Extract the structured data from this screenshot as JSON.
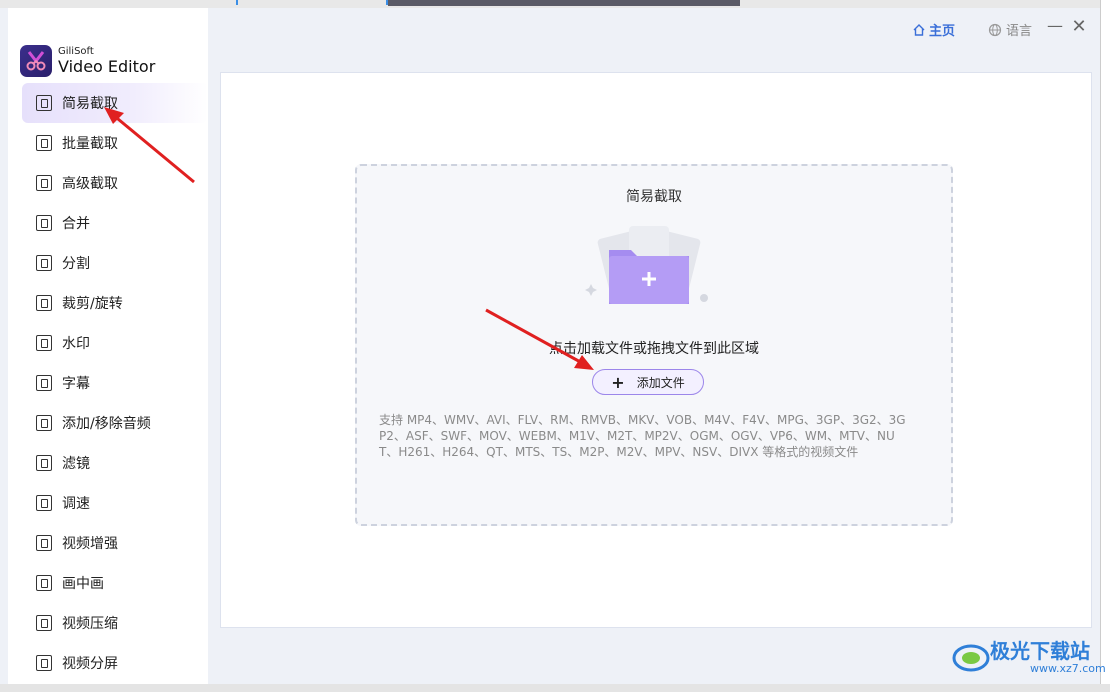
{
  "app": {
    "brand": "GiliSoft",
    "product": "Video Editor"
  },
  "topbar": {
    "home_label": "主页",
    "language_label": "语言",
    "minimize_glyph": "—",
    "close_glyph": "✕"
  },
  "sidebar": {
    "items": [
      {
        "label": "简易截取",
        "icon": "simple-cut-icon",
        "active": true
      },
      {
        "label": "批量截取",
        "icon": "batch-cut-icon"
      },
      {
        "label": "高级截取",
        "icon": "advanced-cut-icon"
      },
      {
        "label": "合并",
        "icon": "merge-icon"
      },
      {
        "label": "分割",
        "icon": "split-icon"
      },
      {
        "label": "裁剪/旋转",
        "icon": "crop-rotate-icon"
      },
      {
        "label": "水印",
        "icon": "watermark-icon"
      },
      {
        "label": "字幕",
        "icon": "subtitle-icon"
      },
      {
        "label": "添加/移除音频",
        "icon": "audio-icon"
      },
      {
        "label": "滤镜",
        "icon": "filter-icon"
      },
      {
        "label": "调速",
        "icon": "speed-icon"
      },
      {
        "label": "视频增强",
        "icon": "enhance-icon"
      },
      {
        "label": "画中画",
        "icon": "pip-icon"
      },
      {
        "label": "视频压缩",
        "icon": "compress-icon"
      },
      {
        "label": "视频分屏",
        "icon": "split-screen-icon"
      }
    ]
  },
  "dropzone": {
    "title": "简易截取",
    "hint": "点击加载文件或拖拽文件到此区域",
    "add_label": "添加文件",
    "formats": "支持 MP4、WMV、AVI、FLV、RM、RMVB、MKV、VOB、M4V、F4V、MPG、3GP、3G2、3GP2、ASF、SWF、MOV、WEBM、M1V、M2T、MP2V、OGM、OGV、VP6、WM、MTV、NUT、H261、H264、QT、MTS、TS、M2P、M2V、MPV、NSV、DIVX 等格式的视频文件"
  },
  "watermark": {
    "text": "极光下载站",
    "url": "www.xz7.com"
  },
  "colors": {
    "accent": "#9c86ea",
    "home_blue": "#3a6fd8",
    "arrow_red": "#e02020"
  }
}
